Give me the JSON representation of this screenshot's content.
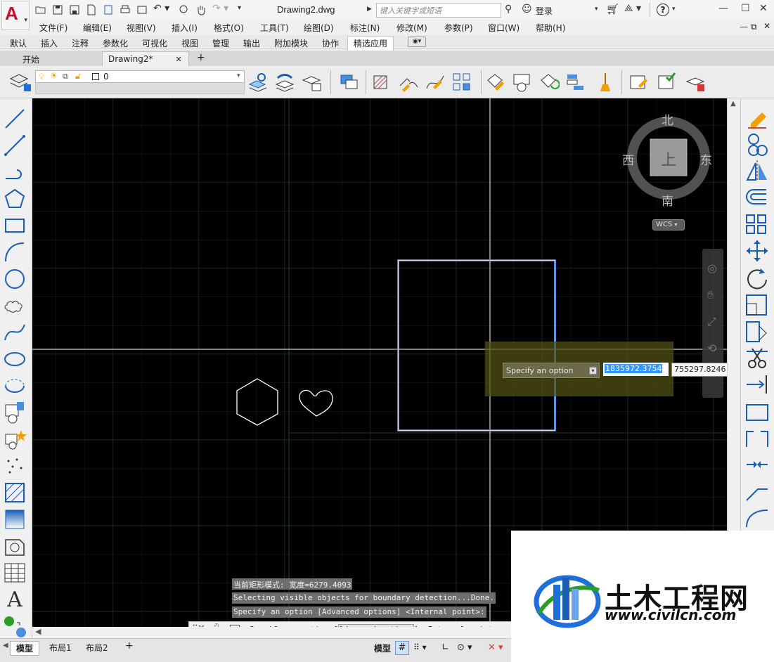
{
  "title_bar": {
    "app_letter": "A",
    "document_title": "Drawing2.dwg",
    "search_placeholder": "键入关键字或短语",
    "login_label": "登录",
    "help_label": "?"
  },
  "menu": [
    "文件(F)",
    "编辑(E)",
    "视图(V)",
    "插入(I)",
    "格式(O)",
    "工具(T)",
    "绘图(D)",
    "标注(N)",
    "修改(M)",
    "参数(P)",
    "窗口(W)",
    "帮助(H)"
  ],
  "ribbon_tabs": {
    "items": [
      "默认",
      "插入",
      "注释",
      "参数化",
      "可视化",
      "视图",
      "管理",
      "输出",
      "附加模块",
      "协作",
      "精选应用"
    ],
    "active": "精选应用"
  },
  "doc_tabs": {
    "start": "开始",
    "drawing": "Drawing2*",
    "close": "✕",
    "add": "+"
  },
  "layer": {
    "current": "0"
  },
  "viewcube": {
    "north": "北",
    "south": "南",
    "east": "东",
    "west": "西",
    "top": "上",
    "wcs": "WCS"
  },
  "dynamic_input": {
    "prompt": "Specify an option",
    "x_value": "1835972.3754",
    "y_value": "755297.8246"
  },
  "command_history": [
    "当前矩形模式:  宽度=6279.4093",
    "Selecting visible objects for boundary detection...Done.",
    "Specify an option [Advanced options] <Internal point>:"
  ],
  "command_line": {
    "prefix": "Specify an option [",
    "highlight": "Advanced options",
    "suffix": "] <Internal point>:"
  },
  "layout_tabs": {
    "model": "模型",
    "layout1": "布局1",
    "layout2": "布局2",
    "add": "+"
  },
  "status_bar": {
    "model_label": "模型"
  },
  "watermark": {
    "chinese": "土木工程网",
    "url": "www.civilcn.com"
  },
  "colors": {
    "canvas": "#000000",
    "crosshair": "#ffffff",
    "selection": "#4a86e8",
    "accent": "#c8102e"
  }
}
